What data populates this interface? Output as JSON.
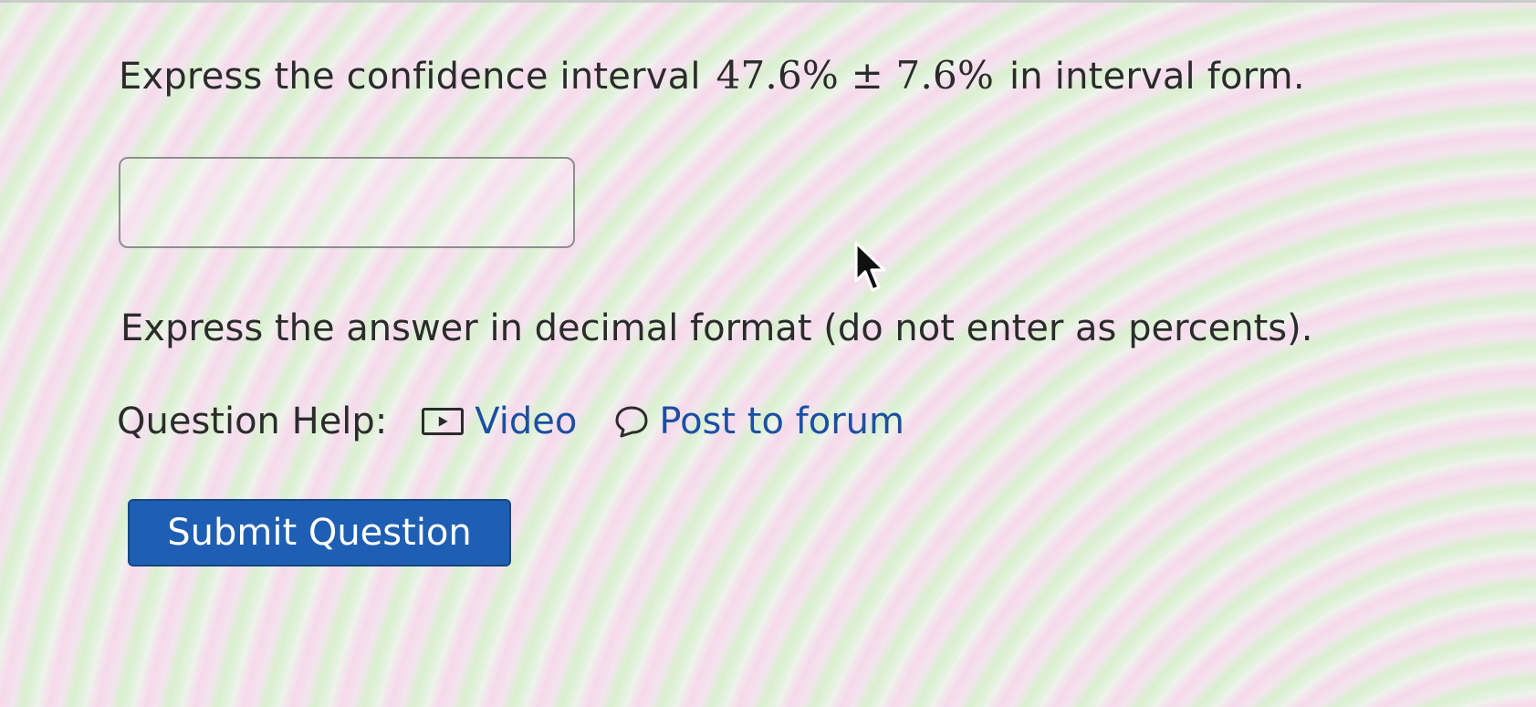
{
  "question": {
    "prefix": "Express the confidence interval",
    "center": "47.6%",
    "plus_minus": "±",
    "margin": "7.6%",
    "suffix": "in interval form."
  },
  "answer_input": {
    "value": "",
    "placeholder": ""
  },
  "instruction": "Express the answer in decimal format (do not enter as percents).",
  "question_help": {
    "label": "Question Help:",
    "video_label": "Video",
    "video_icon": "video-play-icon",
    "forum_label": "Post to forum",
    "forum_icon": "speech-bubble-icon"
  },
  "submit_button": {
    "label": "Submit Question"
  },
  "colors": {
    "link": "#1d4fa0",
    "button": "#1f5fb3",
    "text": "#2b2b2b"
  }
}
